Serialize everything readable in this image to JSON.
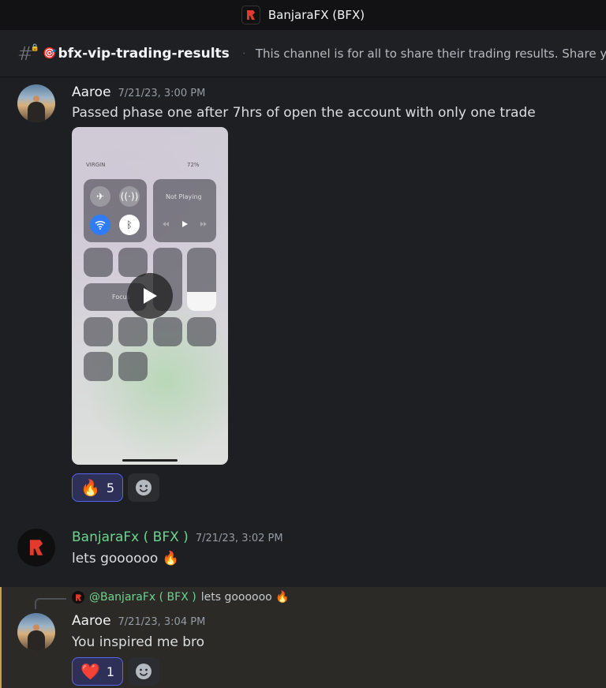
{
  "window": {
    "server_title": "BanjaraFX (BFX)"
  },
  "channel": {
    "emoji": "🎯",
    "name": "bfx-vip-trading-results",
    "topic": "This channel is for all to share their trading results. Share your t"
  },
  "messages": [
    {
      "author": "Aaroe",
      "timestamp": "7/21/23, 3:00 PM",
      "text": "Passed phase one after 7hrs of open the account with only one trade",
      "attachment": {
        "kind": "video",
        "carrier": "VIRGIN",
        "battery": "72%",
        "now_playing": "Not Playing",
        "focus_label": "Focus"
      },
      "reactions": [
        {
          "emoji": "🔥",
          "count": "5"
        }
      ]
    },
    {
      "author": "BanjaraFx ( BFX )",
      "timestamp": "7/21/23, 3:02 PM",
      "text": "lets goooooo 🔥"
    },
    {
      "reply_to": {
        "author": "@BanjaraFx ( BFX )",
        "text": "lets goooooo 🔥"
      },
      "author": "Aaroe",
      "timestamp": "7/21/23, 3:04 PM",
      "text": "You inspired me bro",
      "reactions": [
        {
          "emoji": "❤️",
          "count": "1"
        }
      ]
    }
  ],
  "colors": {
    "accent": "#5865f2",
    "brand_author": "#6fd38e",
    "highlight_bar": "#c9a04a"
  }
}
